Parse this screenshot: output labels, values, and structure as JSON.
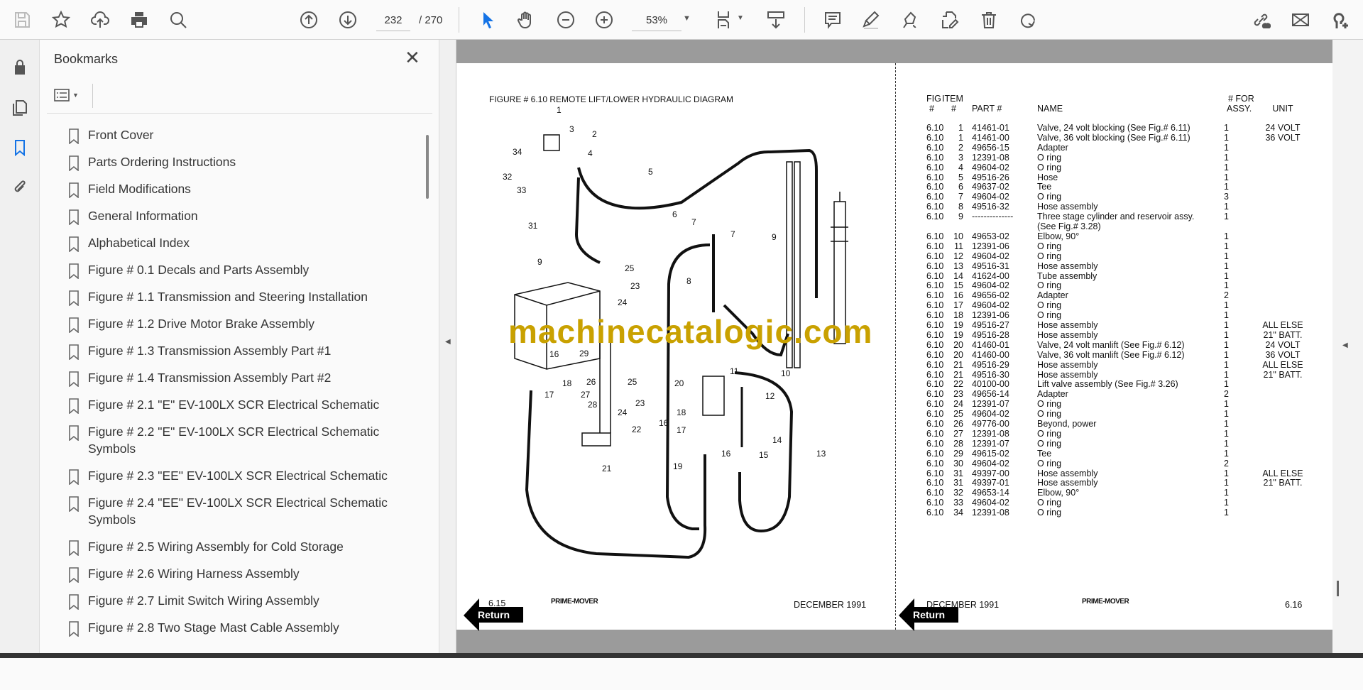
{
  "toolbar": {
    "page_current": "232",
    "page_total": "/ 270",
    "zoom": "53%",
    "icons": [
      "save-icon",
      "bookmark-star-icon",
      "upload-icon",
      "print-icon",
      "find-icon",
      "previous-page-icon",
      "next-page-icon",
      "select-cursor-icon",
      "hand-icon",
      "zoom-out-icon",
      "zoom-in-icon",
      "fit-page-icon",
      "scroll-mode-icon",
      "comment-icon",
      "highlight-icon",
      "sign-icon",
      "edit-pdf-icon",
      "delete-icon",
      "rotate-icon",
      "share-link-icon",
      "email-icon",
      "add-user-icon"
    ]
  },
  "bookmarks": {
    "title": "Bookmarks",
    "close": "✕",
    "items": [
      "Front Cover",
      "Parts Ordering Instructions",
      "Field Modifications",
      "General Information",
      "Alphabetical Index",
      "Figure # 0.1 Decals and Parts Assembly",
      "Figure # 1.1 Transmission and Steering Installation",
      "Figure # 1.2 Drive Motor Brake Assembly",
      "Figure # 1.3 Transmission Assembly Part #1",
      "Figure # 1.4 Transmission Assembly Part #2",
      "Figure # 2.1 \"E\" EV-100LX SCR Electrical Schematic",
      "Figure # 2.2 \"E\" EV-100LX SCR Electrical Schematic Symbols",
      "Figure # 2.3 \"EE\" EV-100LX SCR Electrical Schematic",
      "Figure # 2.4 \"EE\" EV-100LX SCR Electrical Schematic Symbols",
      "Figure # 2.5 Wiring Assembly for Cold Storage",
      "Figure # 2.6 Wiring Harness Assembly",
      "Figure # 2.7 Limit Switch Wiring Assembly",
      "Figure # 2.8 Two Stage Mast Cable Assembly"
    ]
  },
  "document": {
    "figure_title": "FIGURE # 6.10  REMOTE LIFT/LOWER HYDRAULIC DIAGRAM",
    "watermark": "machinecatalogic.com",
    "callouts": [
      "1",
      "2",
      "3",
      "4",
      "34",
      "32",
      "33",
      "5",
      "31",
      "6",
      "7",
      "7",
      "8",
      "9",
      "9",
      "25",
      "23",
      "24",
      "16",
      "29",
      "26",
      "18",
      "17",
      "27",
      "28",
      "25",
      "23",
      "24",
      "22",
      "20",
      "11",
      "10",
      "12",
      "18",
      "17",
      "16",
      "16",
      "14",
      "15",
      "13",
      "19",
      "21"
    ],
    "table": {
      "headers": {
        "fig": "FIG",
        "fig2": "#",
        "item": "ITEM",
        "item2": "#",
        "part": "PART #",
        "name": "NAME",
        "assy": "# FOR",
        "assy2": "ASSY.",
        "unit": "UNIT"
      },
      "rows": [
        [
          "6.10",
          "1",
          "41461-01",
          "Valve, 24 volt blocking (See Fig.# 6.11)",
          "1",
          "24 VOLT"
        ],
        [
          "6.10",
          "1",
          "41461-00",
          "Valve, 36 volt blocking (See Fig.# 6.11)",
          "1",
          "36 VOLT"
        ],
        [
          "6.10",
          "2",
          "49656-15",
          "Adapter",
          "1",
          ""
        ],
        [
          "6.10",
          "3",
          "12391-08",
          "O ring",
          "1",
          ""
        ],
        [
          "6.10",
          "4",
          "49604-02",
          "O ring",
          "1",
          ""
        ],
        [
          "6.10",
          "5",
          "49516-26",
          "Hose",
          "1",
          ""
        ],
        [
          "6.10",
          "6",
          "49637-02",
          "Tee",
          "1",
          ""
        ],
        [
          "6.10",
          "7",
          "49604-02",
          "O ring",
          "3",
          ""
        ],
        [
          "6.10",
          "8",
          "49516-32",
          "Hose assembly",
          "1",
          ""
        ],
        [
          "6.10",
          "9",
          "--------------",
          "Three stage cylinder and reservoir assy.",
          "1",
          ""
        ],
        [
          "",
          "",
          "",
          "(See Fig.# 3.28)",
          "",
          ""
        ],
        [
          "6.10",
          "10",
          "49653-02",
          "Elbow, 90°",
          "1",
          ""
        ],
        [
          "6.10",
          "11",
          "12391-06",
          "O ring",
          "1",
          ""
        ],
        [
          "6.10",
          "12",
          "49604-02",
          "O ring",
          "1",
          ""
        ],
        [
          "6.10",
          "13",
          "49516-31",
          "Hose assembly",
          "1",
          ""
        ],
        [
          "6.10",
          "14",
          "41624-00",
          "Tube assembly",
          "1",
          ""
        ],
        [
          "6.10",
          "15",
          "49604-02",
          "O ring",
          "1",
          ""
        ],
        [
          "6.10",
          "16",
          "49656-02",
          "Adapter",
          "2",
          ""
        ],
        [
          "6.10",
          "17",
          "49604-02",
          "O ring",
          "1",
          ""
        ],
        [
          "6.10",
          "18",
          "12391-06",
          "O ring",
          "1",
          ""
        ],
        [
          "6.10",
          "19",
          "49516-27",
          "Hose assembly",
          "1",
          "ALL ELSE"
        ],
        [
          "6.10",
          "19",
          "49516-28",
          "Hose assembly",
          "1",
          "21\" BATT."
        ],
        [
          "6.10",
          "20",
          "41460-01",
          "Valve, 24 volt manlift (See Fig.# 6.12)",
          "1",
          "24 VOLT"
        ],
        [
          "6.10",
          "20",
          "41460-00",
          "Valve, 36 volt manlift (See Fig.# 6.12)",
          "1",
          "36 VOLT"
        ],
        [
          "6.10",
          "21",
          "49516-29",
          "Hose assembly",
          "1",
          "ALL ELSE"
        ],
        [
          "6.10",
          "21",
          "49516-30",
          "Hose assembly",
          "1",
          "21\" BATT."
        ],
        [
          "6.10",
          "22",
          "40100-00",
          "Lift valve assembly (See Fig.# 3.26)",
          "1",
          ""
        ],
        [
          "6.10",
          "23",
          "49656-14",
          "Adapter",
          "2",
          ""
        ],
        [
          "6.10",
          "24",
          "12391-07",
          "O ring",
          "1",
          ""
        ],
        [
          "6.10",
          "25",
          "49604-02",
          "O ring",
          "1",
          ""
        ],
        [
          "6.10",
          "26",
          "49776-00",
          "Beyond, power",
          "1",
          ""
        ],
        [
          "6.10",
          "27",
          "12391-08",
          "O ring",
          "1",
          ""
        ],
        [
          "6.10",
          "28",
          "12391-07",
          "O ring",
          "1",
          ""
        ],
        [
          "6.10",
          "29",
          "49615-02",
          "Tee",
          "1",
          ""
        ],
        [
          "6.10",
          "30",
          "49604-02",
          "O ring",
          "2",
          ""
        ],
        [
          "6.10",
          "31",
          "49397-00",
          "Hose assembly",
          "1",
          "ALL ELSE"
        ],
        [
          "6.10",
          "31",
          "49397-01",
          "Hose assembly",
          "1",
          "21\" BATT."
        ],
        [
          "6.10",
          "32",
          "49653-14",
          "Elbow, 90°",
          "1",
          ""
        ],
        [
          "6.10",
          "33",
          "49604-02",
          "O ring",
          "1",
          ""
        ],
        [
          "6.10",
          "34",
          "12391-08",
          "O ring",
          "1",
          ""
        ]
      ]
    },
    "footer_left": {
      "page": "6.15",
      "date": "DECEMBER 1991",
      "return": "Return",
      "logo": "PRIME-MOVER"
    },
    "footer_right": {
      "page": "6.16",
      "date": "DECEMBER 1991",
      "return": "Return",
      "logo": "PRIME-MOVER"
    }
  },
  "colors": {
    "accent": "#1473e6",
    "watermark": "#c9a100",
    "doc_bg": "#9b9b9b"
  }
}
